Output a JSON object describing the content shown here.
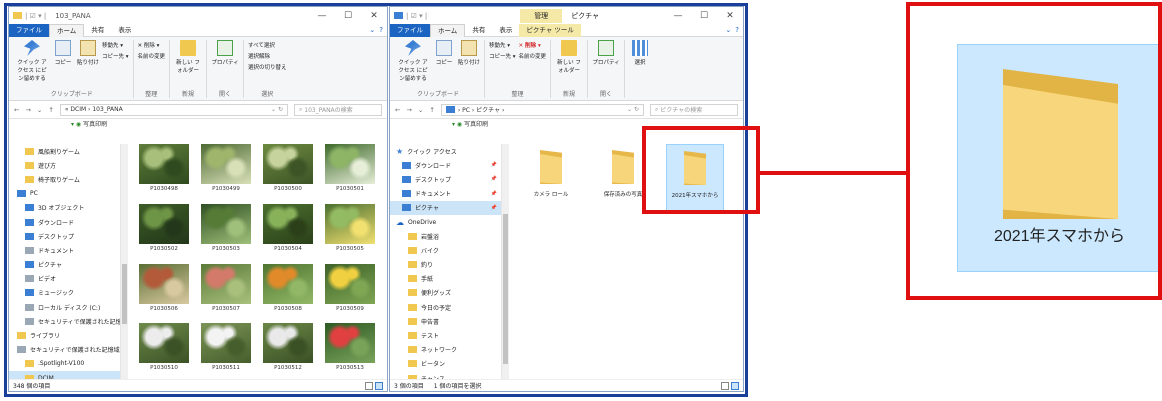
{
  "left_window": {
    "title": "103_PANA",
    "menu": [
      "ファイル",
      "ホーム",
      "共有",
      "表示"
    ],
    "ribbon": {
      "clipboard": {
        "pin": "クイック アクセス にピン留めする",
        "copy": "コピー",
        "paste": "貼り付け",
        "small": [
          "移動先 ▾",
          "コピー先 ▾"
        ],
        "label": "クリップボード"
      },
      "organize": {
        "small": [
          "✕ 削除 ▾",
          "名前の変更"
        ],
        "label": "整理"
      },
      "new": {
        "btn": "新しい フォルダー",
        "label": "新規"
      },
      "open": {
        "btn": "プロパティ",
        "label": "開く"
      },
      "select": {
        "small": [
          "すべて選択",
          "選択解除",
          "選択の切り替え"
        ],
        "label": "選択"
      }
    },
    "address": "« DCIM › 103_PANA",
    "search_placeholder": "103_PANAの検索",
    "subhead": "写真印刷",
    "nav": [
      "風船割りゲーム",
      "遊び方",
      "椅子取りゲーム",
      "PC",
      "3D オブジェクト",
      "ダウンロード",
      "デスクトップ",
      "ドキュメント",
      "ピクチャ",
      "ビデオ",
      "ミュージック",
      "ローカル ディスク (C:)",
      "セキュリティで保護された記憶域",
      "ライブラリ",
      "セキュリティで保護された記憶域",
      ".Spotlight-V100",
      "DCIM"
    ],
    "photos": [
      "P1030498",
      "P1030499",
      "P1030500",
      "P1030501",
      "P1030502",
      "P1030503",
      "P1030504",
      "P1030505",
      "P1030506",
      "P1030507",
      "P1030508",
      "P1030509",
      "P1030510",
      "P1030511",
      "P1030512",
      "P1030513"
    ],
    "status": "348 個の項目"
  },
  "right_window": {
    "context_tab": "管理",
    "title": "ピクチャ",
    "menu": [
      "ファイル",
      "ホーム",
      "共有",
      "表示",
      "ピクチャ ツール"
    ],
    "ribbon": {
      "clipboard": {
        "pin": "クイック アクセス にピン留めする",
        "copy": "コピー",
        "paste": "貼り付け",
        "label": "クリップボード"
      },
      "organize": {
        "small": [
          "移動先 ▾",
          "✕ 削除 ▾",
          "コピー先 ▾",
          "名前の変更"
        ],
        "label": "整理"
      },
      "new": {
        "btn": "新しい フォルダー",
        "label": "新規"
      },
      "open": {
        "btn": "プロパティ",
        "label": "開く"
      },
      "select": {
        "btn": "選択",
        "label": ""
      }
    },
    "address": "› PC › ピクチャ ›",
    "search_placeholder": "ピクチャの検索",
    "subhead": "写真印刷",
    "nav": [
      "クイック アクセス",
      "ダウンロード",
      "デスクトップ",
      "ドキュメント",
      "ピクチャ",
      "OneDrive",
      "岩盤浴",
      "バイク",
      "釣り",
      "手紙",
      "便利グッズ",
      "今日の予定",
      "申告書",
      "テスト",
      "ネットワーク",
      "ビータン",
      "チャンス"
    ],
    "folders": [
      "カメラ ロール",
      "保存済みの写真",
      "2021年スマホから"
    ],
    "status": "3 個の項目",
    "status_sel": "1 個の項目を選択"
  },
  "zoom": {
    "caption": "2021年スマホから"
  },
  "colors": {
    "accent": "#1c64c2",
    "highlight": "#e01010",
    "selection": "#cce8ff",
    "folder": "#f7d57a",
    "frame": "#1a3f9a"
  }
}
